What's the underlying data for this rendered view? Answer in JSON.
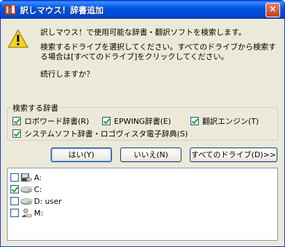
{
  "window": {
    "title": "訳しマウス！辞書追加",
    "close_glyph": "×"
  },
  "message": {
    "line1": "訳しマウス！で使用可能な辞書・翻訳ソフトを検索します。",
    "line2": "検索するドライブを選択してください。すべてのドライブから検索す",
    "line3": "る場合は[すべてのドライブ]をクリックしてください。",
    "line4": "続行しますか？"
  },
  "search_group": {
    "label": "検索する辞書",
    "options": [
      {
        "label": "ロボワード辞書(R)",
        "checked": true
      },
      {
        "label": "EPWING辞書(E)",
        "checked": true
      },
      {
        "label": "翻訳エンジン(T)",
        "checked": true
      },
      {
        "label": "システムソフト辞書・ロゴヴィスタ電子辞典(S)",
        "checked": true
      }
    ]
  },
  "buttons": {
    "yes": "はい(Y)",
    "no": "いいえ(N)",
    "all_drives": "すべてのドライブ(D)>>"
  },
  "drives": [
    {
      "label": "A:",
      "checked": false,
      "icon": "floppy-drive-icon"
    },
    {
      "label": "C:",
      "checked": true,
      "icon": "hard-drive-icon"
    },
    {
      "label": "D: user",
      "checked": false,
      "icon": "hard-drive-icon"
    },
    {
      "label": "M:",
      "checked": false,
      "icon": "network-drive-icon"
    }
  ]
}
